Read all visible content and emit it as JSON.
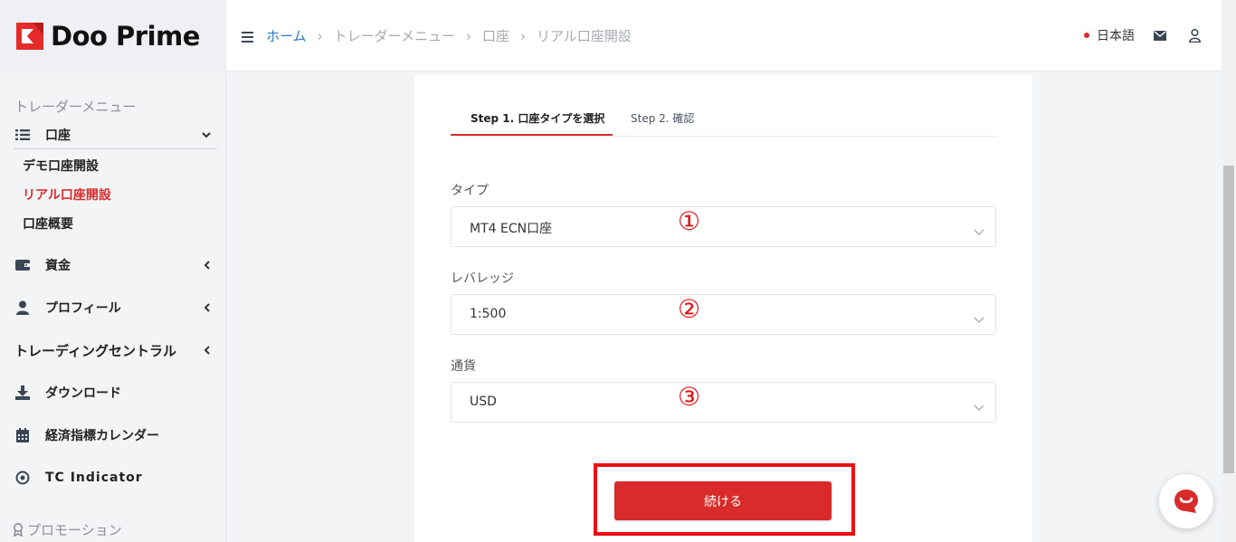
{
  "brand": {
    "name": "Doo Prime",
    "accent": "#d92b2b",
    "link": "#2a7ac6"
  },
  "sidebar": {
    "section_label": "トレーダーメニュー",
    "account_group": {
      "label": "口座",
      "icon": "list-icon"
    },
    "account_items": [
      {
        "label": "デモ口座開設",
        "active": false
      },
      {
        "label": "リアル口座開設",
        "active": true
      },
      {
        "label": "口座概要",
        "active": false
      }
    ],
    "groups": [
      {
        "label": "資金",
        "icon": "wallet-icon"
      },
      {
        "label": "プロフィール",
        "icon": "user-icon"
      },
      {
        "label": "トレーディングセントラル",
        "icon": ""
      },
      {
        "label": "ダウンロード",
        "icon": "download-icon"
      },
      {
        "label": "経済指標カレンダー",
        "icon": "calendar-icon"
      },
      {
        "label": "TC Indicator",
        "icon": "target-icon"
      }
    ],
    "promotion_label": "プロモーション"
  },
  "header": {
    "breadcrumb": [
      "ホーム",
      "トレーダーメニュー",
      "口座",
      "リアル口座開設"
    ],
    "language": "日本語"
  },
  "form": {
    "tabs": [
      "Step 1. 口座タイプを選択",
      "Step 2. 確認"
    ],
    "fields": [
      {
        "label": "タイプ",
        "value": "MT4 ECN口座",
        "marker": "①"
      },
      {
        "label": "レバレッジ",
        "value": "1:500",
        "marker": "②"
      },
      {
        "label": "通貨",
        "value": "USD",
        "marker": "③"
      }
    ],
    "continue_label": "続ける"
  }
}
